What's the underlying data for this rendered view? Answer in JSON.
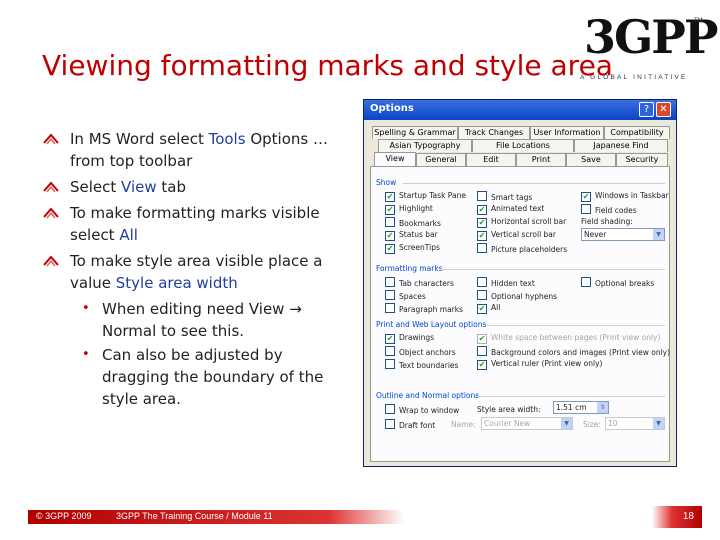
{
  "slide": {
    "title": "Viewing formatting marks and style area",
    "logo": {
      "main": "3GPP",
      "sub": "A GLOBAL INITIATIVE",
      "reg": "TM"
    },
    "bullets": [
      {
        "pre": "In MS Word select ",
        "hl": "Tools",
        "post": " Options … from top toolbar"
      },
      {
        "pre": "Select ",
        "hl": "View",
        "post": " tab"
      },
      {
        "pre": "To make formatting marks visible select ",
        "hl": "All",
        "post": ""
      },
      {
        "pre": "To make style area visible place a value  ",
        "hl": "Style area width",
        "post": ""
      }
    ],
    "sub_bullets": [
      "When editing need View → Normal to see this.",
      "Can also be adjusted by dragging the boundary of the style area."
    ],
    "footer": {
      "copyright": "© 3GPP 2009",
      "course": "3GPP The Training Course / Module 11",
      "page": "18"
    }
  },
  "dialog": {
    "title": "Options",
    "help_btn": "?",
    "close_btn": "✕",
    "tabs_row1": [
      "Spelling & Grammar",
      "Track Changes",
      "User Information",
      "Compatibility"
    ],
    "tabs_row2": [
      "Asian Typography",
      "File Locations",
      "Japanese Find"
    ],
    "tabs_row3": [
      "View",
      "General",
      "Edit",
      "Print",
      "Save",
      "Security"
    ],
    "show": {
      "label": "Show",
      "col1": [
        "Startup Task Pane",
        "Highlight",
        "Bookmarks",
        "Status bar",
        "ScreenTips"
      ],
      "col1_checked": [
        true,
        true,
        false,
        true,
        true
      ],
      "col2": [
        "Smart tags",
        "Animated text",
        "Horizontal scroll bar",
        "Vertical scroll bar",
        "Picture placeholders"
      ],
      "col2_checked": [
        false,
        true,
        true,
        true,
        false
      ],
      "col3": [
        "Windows in Taskbar",
        "Field codes"
      ],
      "col3_checked": [
        true,
        false
      ],
      "field_shading_label": "Field shading:",
      "field_shading_value": "Never"
    },
    "formatting": {
      "label": "Formatting marks",
      "col1": [
        "Tab characters",
        "Spaces",
        "Paragraph marks"
      ],
      "col2": [
        "Hidden text",
        "Optional hyphens",
        "All"
      ],
      "col2_checked": [
        false,
        false,
        true
      ],
      "col3": [
        "Optional breaks"
      ]
    },
    "print_web": {
      "label": "Print and Web Layout options",
      "col1": [
        "Drawings",
        "Object anchors",
        "Text boundaries"
      ],
      "col1_checked": [
        true,
        false,
        false
      ],
      "col2": [
        "White space between pages (Print view only)",
        "Background colors and images (Print view only)",
        "Vertical ruler (Print view only)"
      ],
      "col2_checked": [
        true,
        false,
        true
      ]
    },
    "outline": {
      "label": "Outline and Normal options",
      "wrap": "Wrap to window",
      "draft": "Draft font",
      "style_area_label": "Style area width:",
      "style_area_value": "1.51 cm",
      "name_label": "Name:",
      "name_value": "Courier New",
      "size_label": "Size:",
      "size_value": "10"
    }
  }
}
